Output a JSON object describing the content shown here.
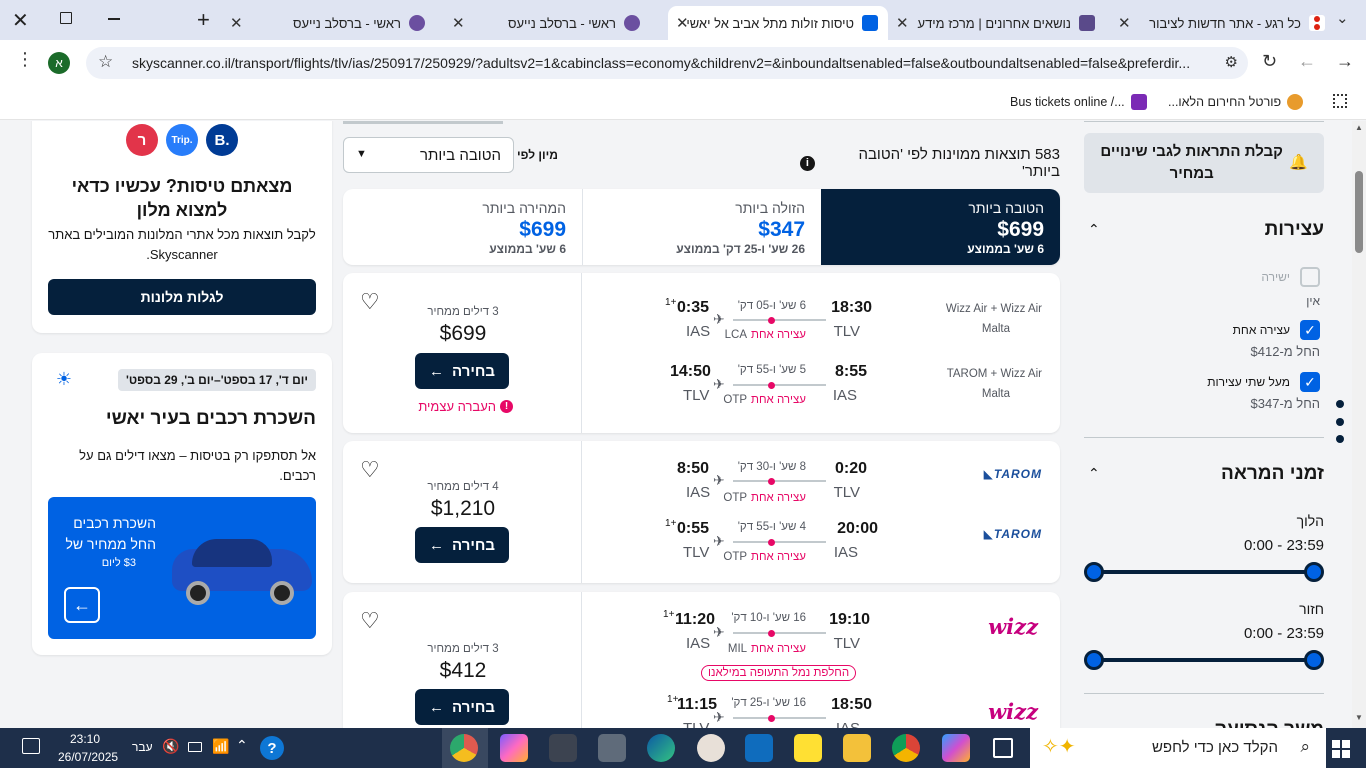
{
  "browser": {
    "tabs": [
      {
        "title": "כל רגע - אתר חדשות לציבור"
      },
      {
        "title": "נושאים אחרונים | מרכז מידע"
      },
      {
        "title": "טיסות זולות מתל אביב אל יאשי"
      },
      {
        "title": "ראשי - ברסלב נייעס"
      },
      {
        "title": "ראשי - ברסלב נייעס"
      }
    ],
    "url": "skyscanner.co.il/transport/flights/tlv/ias/250917/250929/?adultsv2=1&cabinclass=economy&childrenv2=&inboundaltsenabled=false&outboundaltsenabled=false&preferdir...",
    "profile_letter": "א",
    "bookmarks": [
      "פורטל החירום הלאו...",
      "Bus tickets online /..."
    ]
  },
  "filters": {
    "alert_button": "קבלת התראות לגבי שינויים במחיר",
    "stops_title": "עצירות",
    "stops": [
      {
        "label": "ישירה",
        "price": "אין",
        "checked": false
      },
      {
        "label": "עצירה אחת",
        "price": "החל מ-$412",
        "checked": true
      },
      {
        "label": "מעל שתי עצירות",
        "price": "החל מ-$347",
        "checked": true
      }
    ],
    "times_title": "זמני המראה",
    "outbound_label": "הלוך",
    "outbound_range": "0:00 - 23:59",
    "return_label": "חזור",
    "return_range": "0:00 - 23:59",
    "next_section_partial": "משך הנסיעה"
  },
  "results": {
    "count_text": "583 תוצאות ממוינות לפי 'הטובה ביותר'",
    "sort_label": "מיון לפי",
    "sort_value": "הטובה ביותר",
    "tabs": [
      {
        "label": "הטובה ביותר",
        "price": "$699",
        "sub": "6 שע' בממוצע",
        "active": true
      },
      {
        "label": "הזולה ביותר",
        "price": "$347",
        "sub": "26 שע' ו-25 דק' בממוצע",
        "active": false
      },
      {
        "label": "המהירה ביותר",
        "price": "$699",
        "sub": "6 שע' בממוצע",
        "active": false
      }
    ],
    "select_label": "בחירה",
    "cards": [
      {
        "deals": "3 דילים ממחיר",
        "price": "$699",
        "warning": "העברה עצמית",
        "legs": [
          {
            "airline": "Wizz Air + Wizz Air",
            "operator": "Malta",
            "dep_time": "18:30",
            "dep_code": "TLV",
            "arr_time": "0:35",
            "plus": "+1",
            "arr_code": "IAS",
            "duration": "6 שע' ו-05 דק'",
            "stop_code": "LCA",
            "stops": "עצירה אחת"
          },
          {
            "airline": "TAROM + Wizz Air",
            "operator": "Malta",
            "dep_time": "8:55",
            "dep_code": "IAS",
            "arr_time": "14:50",
            "plus": "",
            "arr_code": "TLV",
            "duration": "5 שע' ו-55 דק'",
            "stop_code": "OTP",
            "stops": "עצירה אחת"
          }
        ]
      },
      {
        "deals": "4 דילים ממחיר",
        "price": "$1,210",
        "warning": "",
        "legs": [
          {
            "airline": "TAROM",
            "operator": "",
            "dep_time": "0:20",
            "dep_code": "TLV",
            "arr_time": "8:50",
            "plus": "",
            "arr_code": "IAS",
            "duration": "8 שע' ו-30 דק'",
            "stop_code": "OTP",
            "stops": "עצירה אחת"
          },
          {
            "airline": "TAROM",
            "operator": "",
            "dep_time": "20:00",
            "dep_code": "IAS",
            "arr_time": "0:55",
            "plus": "+1",
            "arr_code": "TLV",
            "duration": "4 שע' ו-55 דק'",
            "stop_code": "OTP",
            "stops": "עצירה אחת"
          }
        ]
      },
      {
        "deals": "3 דילים ממחיר",
        "price": "$412",
        "warning": "",
        "airport_change": "החלפת נמל התעופה במילאנו",
        "legs": [
          {
            "airline": "wizz",
            "operator": "",
            "dep_time": "19:10",
            "dep_code": "TLV",
            "arr_time": "11:20",
            "plus": "+1",
            "arr_code": "IAS",
            "duration": "16 שע' ו-10 דק'",
            "stop_code": "MIL",
            "stops": "עצירה אחת"
          },
          {
            "airline": "wizz",
            "operator": "",
            "dep_time": "18:50",
            "dep_code": "IAS",
            "arr_time": "11:15",
            "plus": "+1",
            "arr_code": "TLV",
            "duration": "16 שע' ו-25 דק'",
            "stop_code": "",
            "stops": ""
          }
        ]
      }
    ]
  },
  "hotels_promo": {
    "title": "מצאתם טיסות? עכשיו כדאי למצוא מלון",
    "text": "לקבל תוצאות מכל אתרי המלונות המובילים באתר Skyscanner.",
    "button": "לגלות מלונות",
    "logo_trip": "Trip.",
    "logo_b": "B."
  },
  "car_promo": {
    "dates": "יום ד', 17 בספט'–יום ב', 29 בספט'",
    "title": "השכרת רכבים בעיר יאשי",
    "text": "אל תסתפקו רק בטיסות – מצאו דילים גם על רכבים.",
    "banner_title": "השכרת רכבים החל ממחיר של",
    "banner_price": "$3 ליום"
  },
  "taskbar": {
    "search_placeholder": "הקלד כאן כדי לחפש",
    "time": "23:10",
    "date": "26/07/2025",
    "lang": "עבר"
  }
}
